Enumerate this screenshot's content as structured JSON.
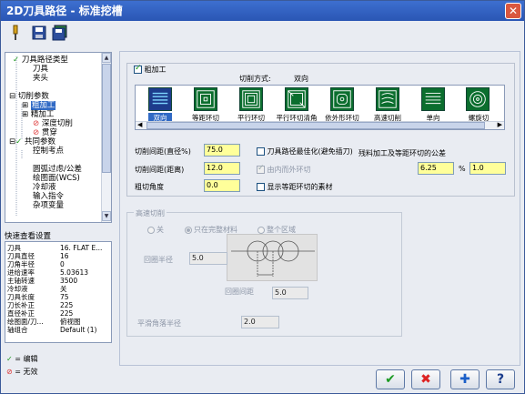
{
  "window": {
    "title": "2D刀具路径 - 标准挖槽",
    "close_glyph": "✕"
  },
  "tree": {
    "items": [
      {
        "label": "刀具路径类型",
        "mark": "check"
      },
      {
        "label": "刀具",
        "mark": ""
      },
      {
        "label": "夹头",
        "mark": ""
      },
      {
        "label": "切削参数",
        "mark": ""
      },
      {
        "label": "粗加工",
        "mark": ""
      },
      {
        "label": "精加工",
        "mark": ""
      },
      {
        "label": "深度切削",
        "mark": "no"
      },
      {
        "label": "贯穿",
        "mark": "no"
      },
      {
        "label": "共同参数",
        "mark": "check"
      },
      {
        "label": "控制考点",
        "mark": ""
      },
      {
        "label": "圆弧过虑/公差",
        "mark": ""
      },
      {
        "label": "绘图面(WCS)",
        "mark": ""
      },
      {
        "label": "冷却液",
        "mark": ""
      },
      {
        "label": "输入指令",
        "mark": ""
      },
      {
        "label": "杂项变量",
        "mark": ""
      }
    ]
  },
  "quick": {
    "title": "快速查看设置",
    "rows": [
      {
        "k": "刀具",
        "v": "16. FLAT E..."
      },
      {
        "k": "刀具直径",
        "v": "16"
      },
      {
        "k": "刀角半径",
        "v": "0"
      },
      {
        "k": "进给速率",
        "v": "5.03613"
      },
      {
        "k": "主轴转速",
        "v": "3500"
      },
      {
        "k": "冷却液",
        "v": "关"
      },
      {
        "k": "刀具长度",
        "v": "75"
      },
      {
        "k": "刀长补正",
        "v": "225"
      },
      {
        "k": "直径补正",
        "v": "225"
      },
      {
        "k": "绘图面/刀...",
        "v": "俯视图"
      },
      {
        "k": "轴组合",
        "v": "Default (1)"
      }
    ]
  },
  "legend": {
    "edit": "= 编辑",
    "invalid": "= 无效"
  },
  "rough": {
    "enable_label": "粗加工",
    "cut_method_label": "切削方式:",
    "cut_method_value": "双向",
    "patterns": [
      "双向",
      "等距环切",
      "平行环切",
      "平行环切清角",
      "依外形环切",
      "高速切削",
      "单向",
      "螺旋切"
    ],
    "selected_index": 0,
    "stepover_pct_label": "切削间距(直径%)",
    "stepover_pct": "75.0",
    "stepover_dist_label": "切削间距(距离)",
    "stepover_dist": "12.0",
    "angle_label": "粗切角度",
    "angle": "0.0",
    "opt_label": "刀具路径最佳化(避免插刀)",
    "inout_label": "由内而外环切",
    "show_stock_label": "显示等距环切的素材",
    "tol_label": "残料加工及等距环切的公差",
    "tol_pct": "6.25",
    "pct_sign": "%",
    "tol_val": "1.0"
  },
  "hs": {
    "title": "高速切削",
    "opt_off": "关",
    "opt_full": "只在完整材料",
    "opt_all": "整个区域",
    "radius_label": "回圈半径",
    "radius": "5.0",
    "pitch_label": "回圈间距",
    "pitch": "5.0",
    "smooth_label": "平滑角落半径",
    "smooth": "2.0"
  },
  "buttons": {
    "ok": "✔",
    "cancel": "✖",
    "add": "✚",
    "help": "?"
  }
}
